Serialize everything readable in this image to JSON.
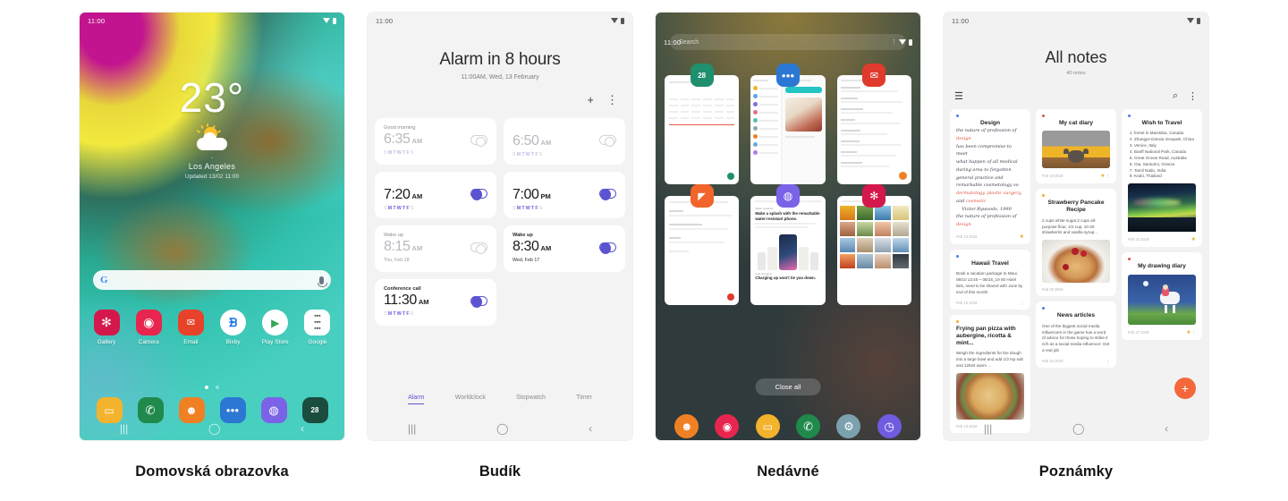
{
  "items": [
    {
      "caption": "Domovská obrazovka",
      "status": {
        "time": "11:00"
      },
      "weather": {
        "temp": "23°",
        "city": "Los Angeles",
        "updated": "Updated 13/02 11:00"
      },
      "search": {
        "logo": "G",
        "placeholder": ""
      },
      "apps": [
        {
          "label": "Gallery",
          "icon": "gallery-icon",
          "glyph": "✻",
          "color": "#d4184b"
        },
        {
          "label": "Camera",
          "icon": "camera-icon",
          "glyph": "◉",
          "color": "#e8254f"
        },
        {
          "label": "Email",
          "icon": "email-icon",
          "glyph": "✉",
          "color": "#e8422a"
        },
        {
          "label": "Bixby",
          "icon": "bixby-icon",
          "glyph": "ᗷ",
          "color": "#ffffff"
        },
        {
          "label": "Play Store",
          "icon": "play-store-icon",
          "glyph": "▶",
          "color": "#ffffff"
        },
        {
          "label": "Google",
          "icon": "google-folder-icon",
          "glyph": "⋮⋮",
          "color": "#ffffff"
        }
      ],
      "dock": [
        {
          "label": "Files",
          "icon": "files-icon",
          "glyph": "▭",
          "color": "#f3b32c"
        },
        {
          "label": "Phone",
          "icon": "phone-icon",
          "glyph": "✆",
          "color": "#1f8a4c"
        },
        {
          "label": "Contacts",
          "icon": "contacts-icon",
          "glyph": "☻",
          "color": "#f08024"
        },
        {
          "label": "Messages",
          "icon": "messages-icon",
          "glyph": "●●●",
          "color": "#2b77d4"
        },
        {
          "label": "Internet",
          "icon": "internet-icon",
          "glyph": "◍",
          "color": "#7b63e8"
        },
        {
          "label": "Calendar",
          "icon": "calendar-icon",
          "glyph": "28",
          "color": "#1b4d3e"
        }
      ],
      "pages": {
        "current": 1,
        "total": 2
      }
    },
    {
      "caption": "Budík",
      "status": {
        "time": "11:00"
      },
      "header": {
        "title": "Alarm in 8 hours",
        "subtitle": "11:00AM, Wed, 13 February"
      },
      "actions": {
        "add": "+",
        "more": "⋮"
      },
      "alarms": [
        {
          "name": "Good morning",
          "time": "6:35",
          "meridiem": "AM",
          "days": "SMTWTFS",
          "active_days": [
            1,
            2,
            3,
            4,
            5
          ],
          "enabled": false
        },
        {
          "name": "",
          "time": "6:50",
          "meridiem": "AM",
          "days": "SMTWTFS",
          "active_days": [
            1,
            2,
            3,
            4,
            5
          ],
          "enabled": false
        },
        {
          "name": "",
          "time": "7:20",
          "meridiem": "AM",
          "days": "SMTWTFS",
          "active_days": [
            1,
            2,
            3,
            4,
            5
          ],
          "enabled": true
        },
        {
          "name": "",
          "time": "7:00",
          "meridiem": "PM",
          "days": "SMTWTFS",
          "active_days": [
            1,
            2,
            3,
            4,
            5
          ],
          "enabled": true
        },
        {
          "name": "Wake up",
          "time": "8:15",
          "meridiem": "AM",
          "date": "Thu, Feb 18",
          "enabled": false
        },
        {
          "name": "Wake up",
          "time": "8:30",
          "meridiem": "AM",
          "date": "Wed, Feb 17",
          "enabled": true
        },
        {
          "name": "Conference call",
          "time": "11:30",
          "meridiem": "AM",
          "days": "SMTWTFS",
          "active_days": [
            1,
            2,
            3,
            4,
            5
          ],
          "enabled": true
        }
      ],
      "tabs": [
        {
          "label": "Alarm",
          "active": true
        },
        {
          "label": "Worldclock",
          "active": false
        },
        {
          "label": "Stopwatch",
          "active": false
        },
        {
          "label": "Timer",
          "active": false
        }
      ]
    },
    {
      "caption": "Nedávné",
      "status": {
        "time": "11:00"
      },
      "search": {
        "placeholder": "Search",
        "more": "⋮"
      },
      "cards": [
        {
          "app": "Calendar",
          "icon": "calendar-icon",
          "glyph": "28",
          "color": "#1f8f6e"
        },
        {
          "app": "Messages",
          "icon": "messages-icon",
          "glyph": "●●●",
          "color": "#2b77d4"
        },
        {
          "app": "Email",
          "icon": "email-icon",
          "glyph": "✉",
          "color": "#e03a2c"
        },
        {
          "app": "Notes",
          "icon": "notes-icon",
          "glyph": "◤",
          "color": "#f2642a"
        },
        {
          "app": "Internet",
          "icon": "internet-icon",
          "glyph": "◍",
          "color": "#7b63e8"
        },
        {
          "app": "Gallery",
          "icon": "gallery-icon",
          "glyph": "✻",
          "color": "#d4184b"
        }
      ],
      "promo": {
        "headline": "Make a splash with the remarkable water-resistant phone.",
        "footer": "Charging up won't tie you down."
      },
      "close_all": "Close all",
      "dock": [
        {
          "label": "Contacts",
          "icon": "contacts-icon",
          "glyph": "☻",
          "color": "#f08024"
        },
        {
          "label": "Camera",
          "icon": "camera-icon",
          "glyph": "◉",
          "color": "#e8254f"
        },
        {
          "label": "Files",
          "icon": "files-icon",
          "glyph": "▭",
          "color": "#f3b32c"
        },
        {
          "label": "Phone",
          "icon": "phone-icon",
          "glyph": "✆",
          "color": "#1f8a4c"
        },
        {
          "label": "Settings",
          "icon": "gear-icon",
          "glyph": "⚙",
          "color": "#7ba1ae"
        },
        {
          "label": "Clock",
          "icon": "clock-icon",
          "glyph": "🕐",
          "color": "#6f5ce0"
        }
      ]
    },
    {
      "caption": "Poznámky",
      "status": {
        "time": "11:00"
      },
      "header": {
        "title": "All notes",
        "subtitle": "40 notes"
      },
      "toolbar": {
        "menu": "☰",
        "search": "⌕",
        "more": "⋮"
      },
      "notes": [
        {
          "title": "Design",
          "kind": "handwriting",
          "date": "Feb 13 2019",
          "dot": "#4a7ef0",
          "star": true
        },
        {
          "title": "Hawaii Travel",
          "body": "Book a vacation  package to Maui. 08/10 13:40 ~ 08/15_19 50 Hotel lists, need to be shared with June by end of this month.",
          "date": "Feb 19 2019",
          "dot": "#4a7ef0",
          "more": true
        },
        {
          "title": "Frying pan pizza with aubergine, ricotta & mint...",
          "body": "Weigh the ingredients for the dough into a large bowl and add 1/2 tsp salt and 125ml warm ...",
          "image": "pizza",
          "date": "Feb 13 2019",
          "dot": "#f0a92e"
        },
        {
          "title": "My cat diary",
          "image": "cat",
          "date": "Feb 19 2019",
          "dot": "#e0523c",
          "star": true,
          "more": true
        },
        {
          "title": "Strawberry Pancake Recipe",
          "body": "2 cups white sugar,2 cups all-purpose flour, 1/2 cup, 10-20 strawberris and vanilla syrup...",
          "image": "pancake",
          "date": "Feb 20 2019",
          "dot": "#f0a92e"
        },
        {
          "title": "News articles",
          "body": "One of the biggest social media influencers in the game has a word of advice for those hoping to strike it rich as a social media influencer: Get a real job",
          "date": "Feb 24 2019",
          "dot": "#4a7ef0",
          "more": true
        },
        {
          "title": "Wish to Travel",
          "list": [
            "forest in Manitoba, Canada",
            "Zhangye Danxia Geopark, China",
            "Venice, Italy",
            "Banff National Park, Canada",
            "Great Ocean Road, Australia",
            "Oia, Santorini, Greece",
            "Tamil Nadu, India",
            "Krabi, Thailand"
          ],
          "image": "aurora",
          "date": "Feb 22 2019",
          "dot": "#4a7ef0",
          "star": true
        },
        {
          "title": "My drawing diary",
          "image": "drawing",
          "date": "Feb 27 2019",
          "dot": "#e0523c",
          "star": true,
          "more": true
        }
      ],
      "fab": "+"
    }
  ],
  "nav": {
    "recents": "|||",
    "home": "◯",
    "back": "‹"
  }
}
